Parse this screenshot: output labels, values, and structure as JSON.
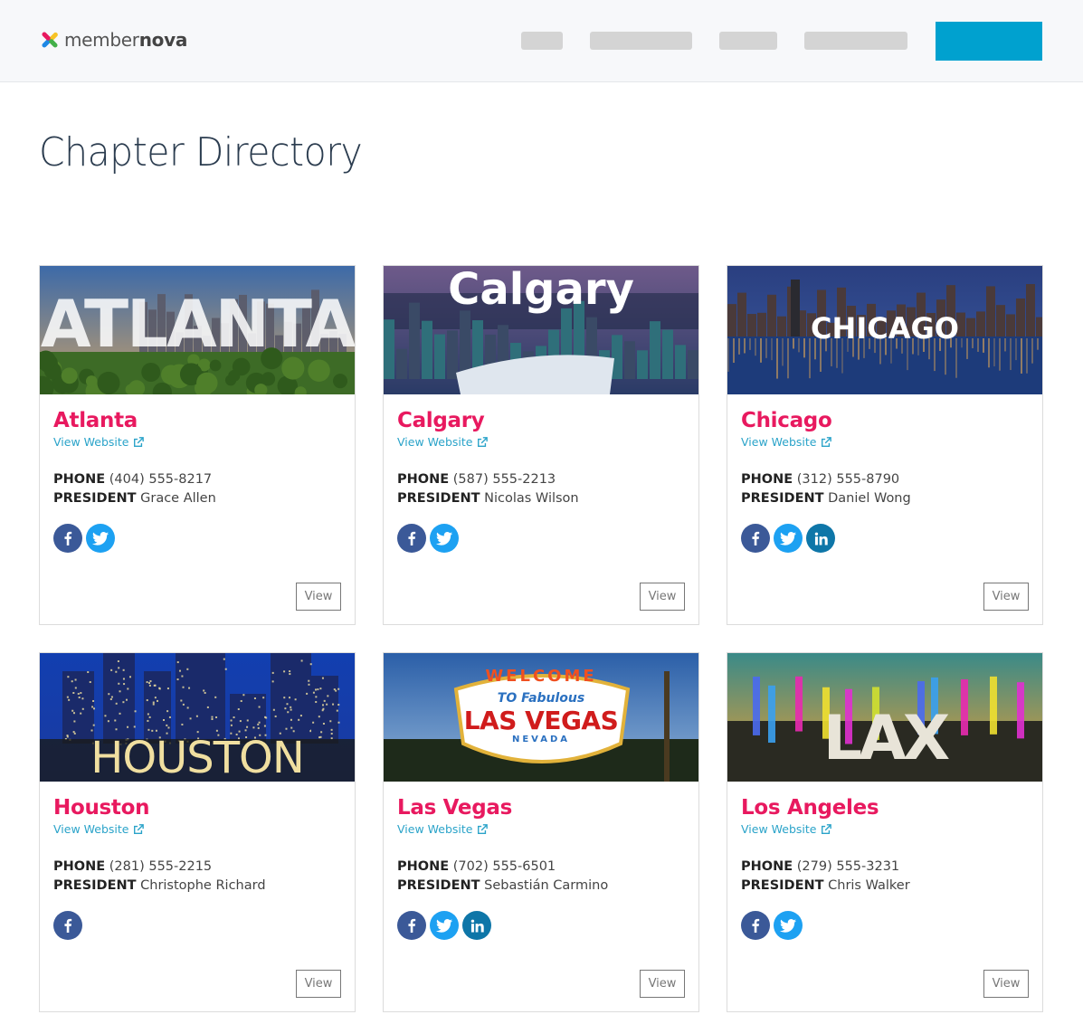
{
  "header": {
    "brand": {
      "prefix": "member",
      "suffix": "nova"
    },
    "nav_placeholders": 4,
    "cta_color": "#00a1cf"
  },
  "page": {
    "title": "Chapter Directory"
  },
  "labels": {
    "phone": "PHONE",
    "president": "PRESIDENT",
    "view_website": "View Website",
    "view_button": "View"
  },
  "colors": {
    "chapter_name": "#e8195f",
    "link": "#2aa3c9",
    "facebook": "#3b5998",
    "twitter": "#1da1f2",
    "linkedin": "#0e76a8"
  },
  "chapters": [
    {
      "name": "Atlanta",
      "banner_text": "ATLANTA",
      "phone": "(404) 555-8217",
      "president": "Grace Allen",
      "socials": [
        "facebook",
        "twitter"
      ]
    },
    {
      "name": "Calgary",
      "banner_text": "Calgary",
      "phone": "(587) 555-2213",
      "president": "Nicolas Wilson",
      "socials": [
        "facebook",
        "twitter"
      ]
    },
    {
      "name": "Chicago",
      "banner_text": "CHICAGO",
      "phone": "(312) 555-8790",
      "president": "Daniel Wong",
      "socials": [
        "facebook",
        "twitter",
        "linkedin"
      ]
    },
    {
      "name": "Houston",
      "banner_text": "HOUSTON",
      "phone": "(281) 555-2215",
      "president": "Christophe Richard",
      "socials": [
        "facebook"
      ]
    },
    {
      "name": "Las Vegas",
      "banner_text": "LAS VEGAS",
      "banner_sub": {
        "top": "WELCOME",
        "mid": "TO Fabulous",
        "bottom": "NEVADA"
      },
      "phone": "(702) 555-6501",
      "president": "Sebastián Carmino",
      "socials": [
        "facebook",
        "twitter",
        "linkedin"
      ]
    },
    {
      "name": "Los Angeles",
      "banner_text": "LAX",
      "phone": "(279) 555-3231",
      "president": "Chris Walker",
      "socials": [
        "facebook",
        "twitter"
      ]
    }
  ]
}
